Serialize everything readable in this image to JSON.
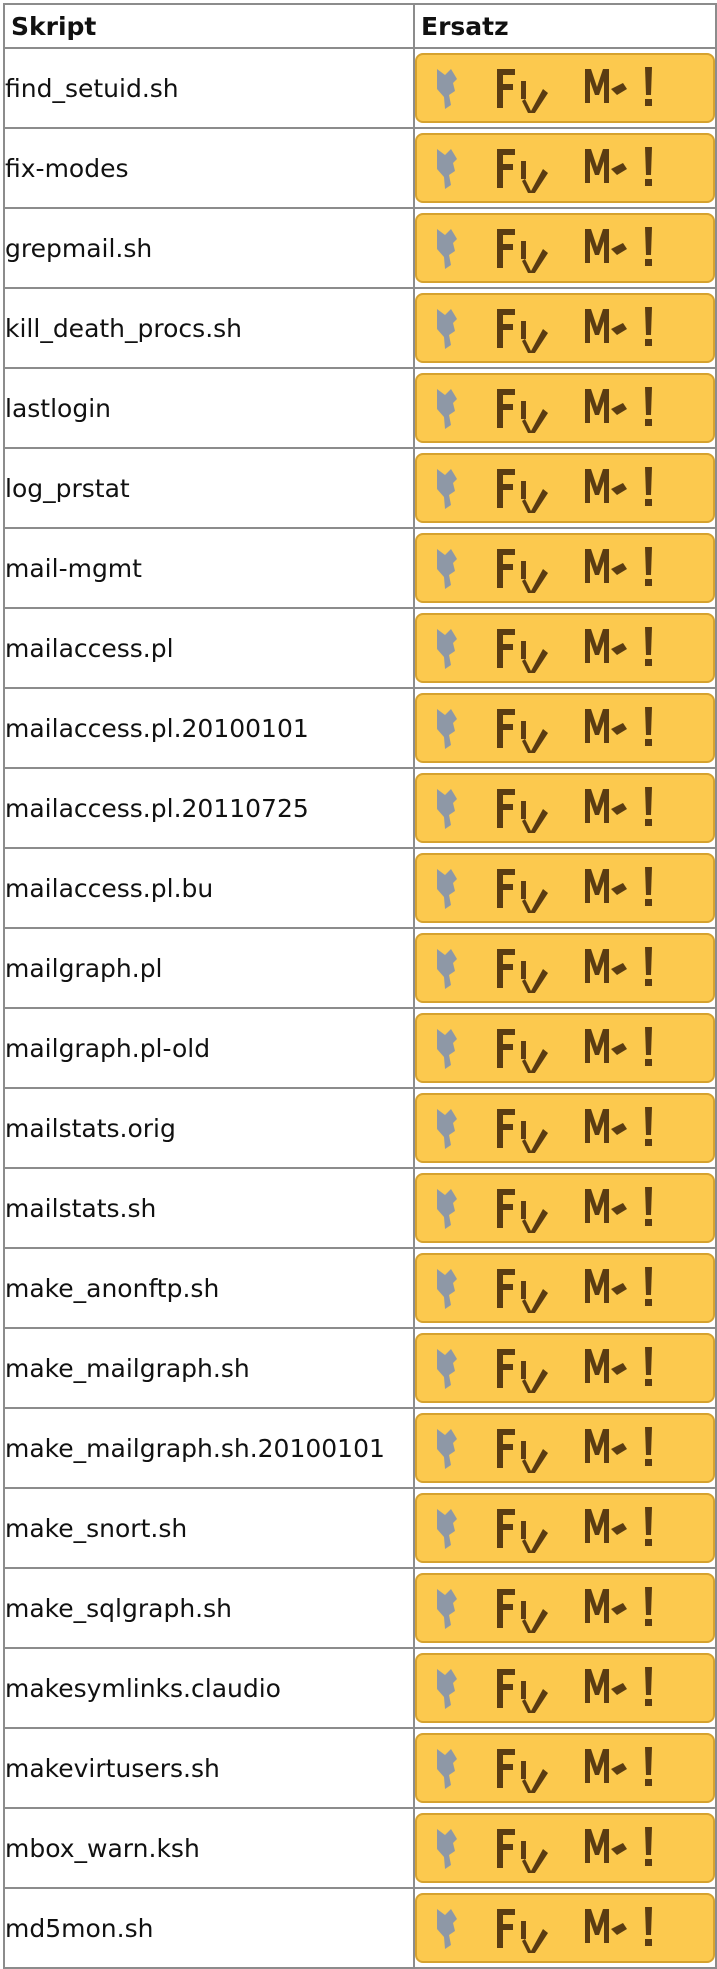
{
  "table": {
    "headers": {
      "script": "Skript",
      "replacement": "Ersatz"
    },
    "badge": {
      "label": "Fix Me!",
      "icon": "wrench-icon",
      "color": "#fcc94e",
      "text_color": "#5a3c12"
    },
    "rows": [
      "find_setuid.sh",
      "fix-modes",
      "grepmail.sh",
      "kill_death_procs.sh",
      "lastlogin",
      "log_prstat",
      "mail-mgmt",
      "mailaccess.pl",
      "mailaccess.pl.20100101",
      "mailaccess.pl.20110725",
      "mailaccess.pl.bu",
      "mailgraph.pl",
      "mailgraph.pl-old",
      "mailstats.orig",
      "mailstats.sh",
      "make_anonftp.sh",
      "make_mailgraph.sh",
      "make_mailgraph.sh.20100101",
      "make_snort.sh",
      "make_sqlgraph.sh",
      "makesymlinks.claudio",
      "makevirtusers.sh",
      "mbox_warn.ksh",
      "md5mon.sh"
    ]
  }
}
